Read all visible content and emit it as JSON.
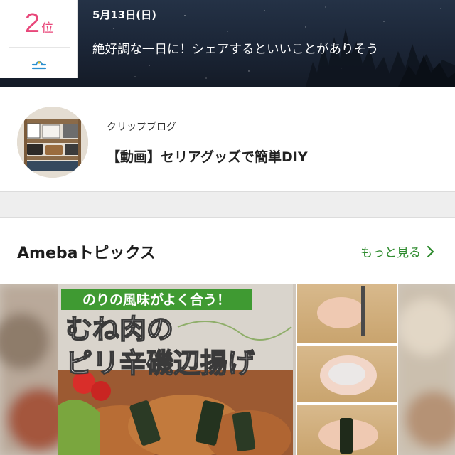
{
  "horoscope": {
    "rank_number": "2",
    "rank_unit": "位",
    "sign_icon": "libra-icon",
    "date": "5月13日(日)",
    "message": "絶好調な一日に！シェアするといいことがありそう"
  },
  "clip_blog": {
    "label": "クリップブログ",
    "title": "【動画】セリアグッズで簡単DIY"
  },
  "topics": {
    "title": "Amebaトピックス",
    "more_label": "もっと見る",
    "more_icon": "chevron-right-icon",
    "banner_tag": "のりの風味がよく合う！",
    "banner_line1": "むね肉の",
    "banner_line2": "ピリ辛磯辺揚げ"
  },
  "colors": {
    "rank_pink": "#e8477a",
    "link_green": "#2e8b2e",
    "tag_green": "#3f9a32"
  }
}
